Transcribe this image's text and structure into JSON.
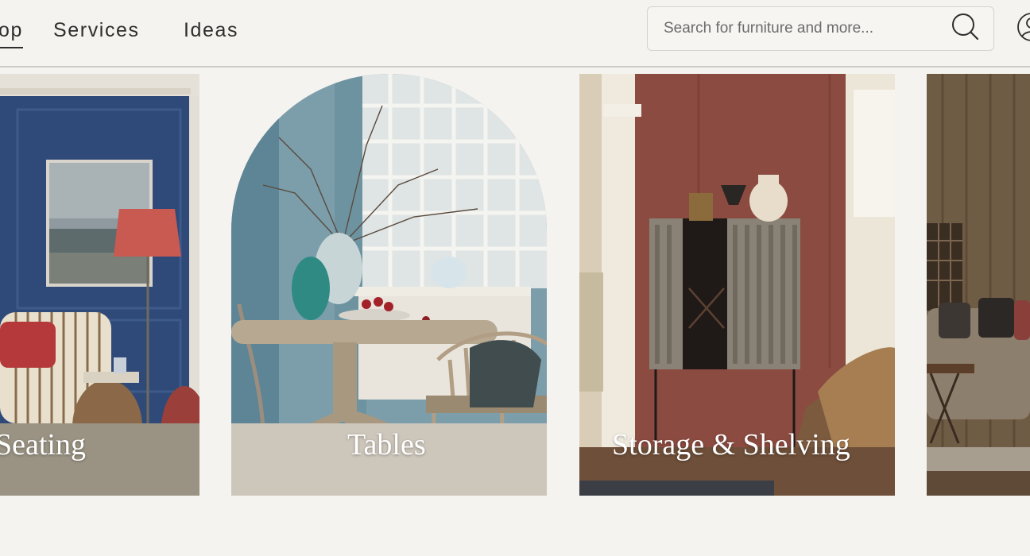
{
  "nav": {
    "items": [
      {
        "label": "op",
        "active": true
      },
      {
        "label": "Services",
        "active": false
      },
      {
        "label": "Ideas",
        "active": false
      }
    ]
  },
  "search": {
    "placeholder": "Search for furniture and more...",
    "value": "",
    "icon": "search-icon"
  },
  "account": {
    "icon": "user-account-icon"
  },
  "categories": [
    {
      "label": "Seating"
    },
    {
      "label": "Tables"
    },
    {
      "label": "Storage & Shelving"
    },
    {
      "label": ""
    }
  ],
  "colors": {
    "background": "#f5f3ef",
    "text": "#2e2e2e",
    "divider": "#cfcbc4",
    "label": "#ffffff"
  }
}
